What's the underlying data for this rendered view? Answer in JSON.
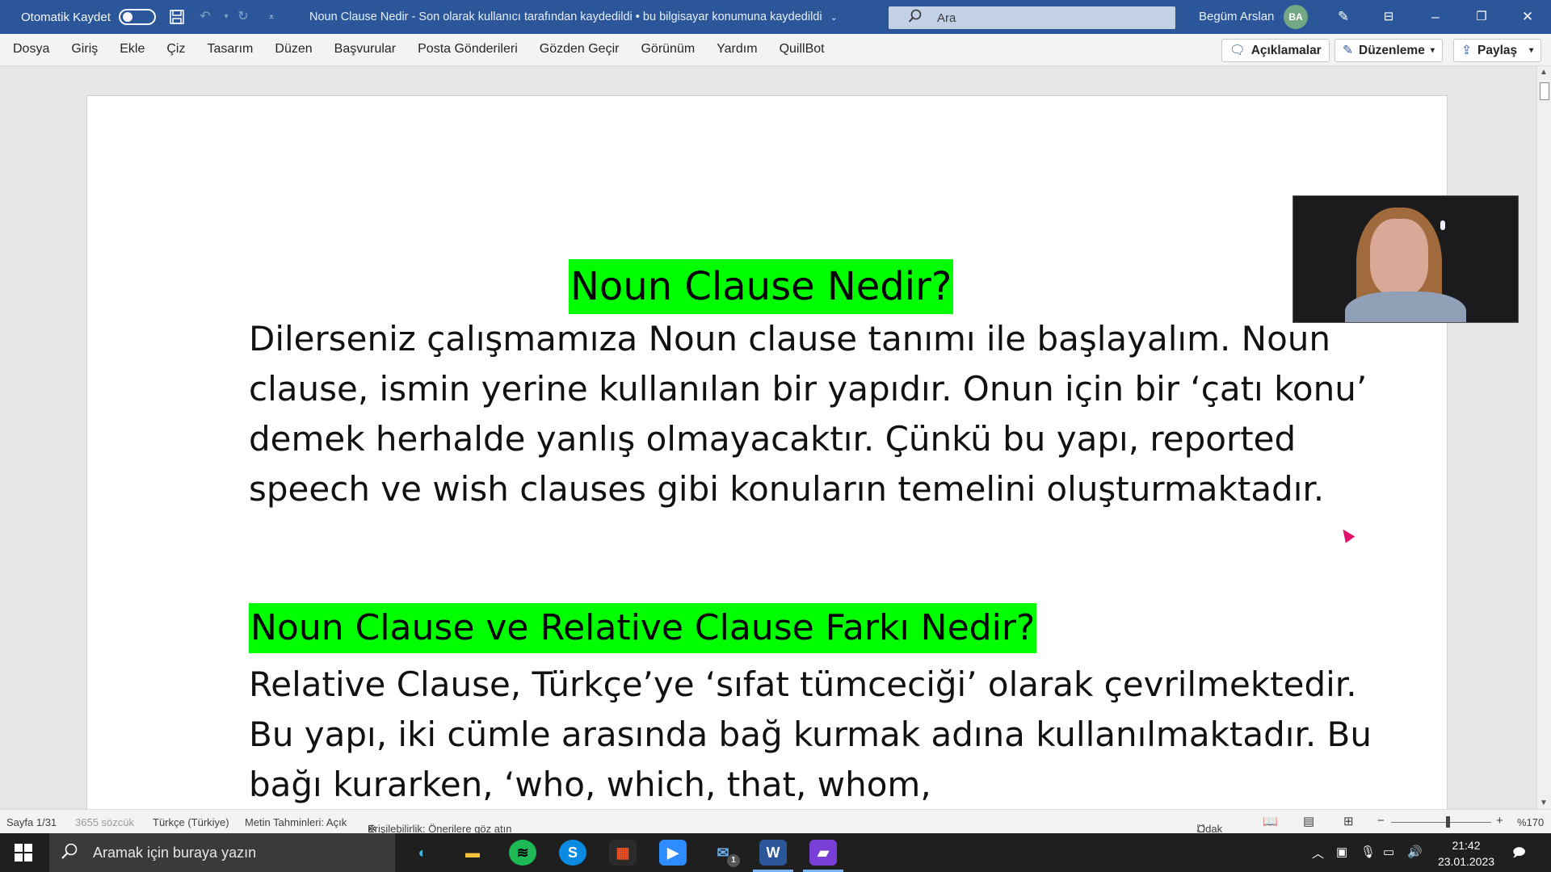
{
  "titlebar": {
    "autosave_label": "Otomatik Kaydet",
    "document_title": "Noun Clause Nedir  -  Son olarak kullanıcı tarafından kaydedildi  •  bu bilgisayar konumuna kaydedildi",
    "search_placeholder": "Ara",
    "user_name": "Begüm Arslan",
    "user_initials": "BA"
  },
  "ribbon": {
    "tabs": [
      "Dosya",
      "Giriş",
      "Ekle",
      "Çiz",
      "Tasarım",
      "Düzen",
      "Başvurular",
      "Posta Gönderileri",
      "Gözden Geçir",
      "Görünüm",
      "Yardım",
      "QuillBot"
    ],
    "comments_label": "Açıklamalar",
    "editing_label": "Düzenleme",
    "share_label": "Paylaş"
  },
  "document": {
    "heading1": "Noun Clause Nedir?",
    "paragraph1": "Dilerseniz çalışmamıza Noun clause tanımı ile başlayalım. Noun clause, ismin yerine kullanılan bir yapıdır. Onun için bir ‘çatı konu’ demek herhalde yanlış olmayacaktır. Çünkü bu yapı, reported speech ve wish clauses gibi konuların temelini oluşturmaktadır.",
    "heading2": "Noun Clause ve Relative Clause Farkı Nedir?",
    "paragraph2": "Relative Clause, Türkçe’ye ‘sıfat tümceciği’ olarak çevrilmektedir. Bu yapı, iki cümle arasında bağ kurmak adına kullanılmaktadır. Bu bağı kurarken, ‘who, which, that, whom,",
    "highlight_color": "#00ff00"
  },
  "statusbar": {
    "page": "Sayfa 1/31",
    "words": "3655 sözcük",
    "language": "Türkçe (Türkiye)",
    "text_predictions": "Metin Tahminleri: Açık",
    "accessibility": "Erişilebilirlik: Önerilere göz atın",
    "focus": "Odak",
    "zoom": "%170"
  },
  "taskbar": {
    "search_placeholder": "Aramak için buraya yazın",
    "time": "21:42",
    "date": "23.01.2023",
    "mail_badge": "1"
  }
}
